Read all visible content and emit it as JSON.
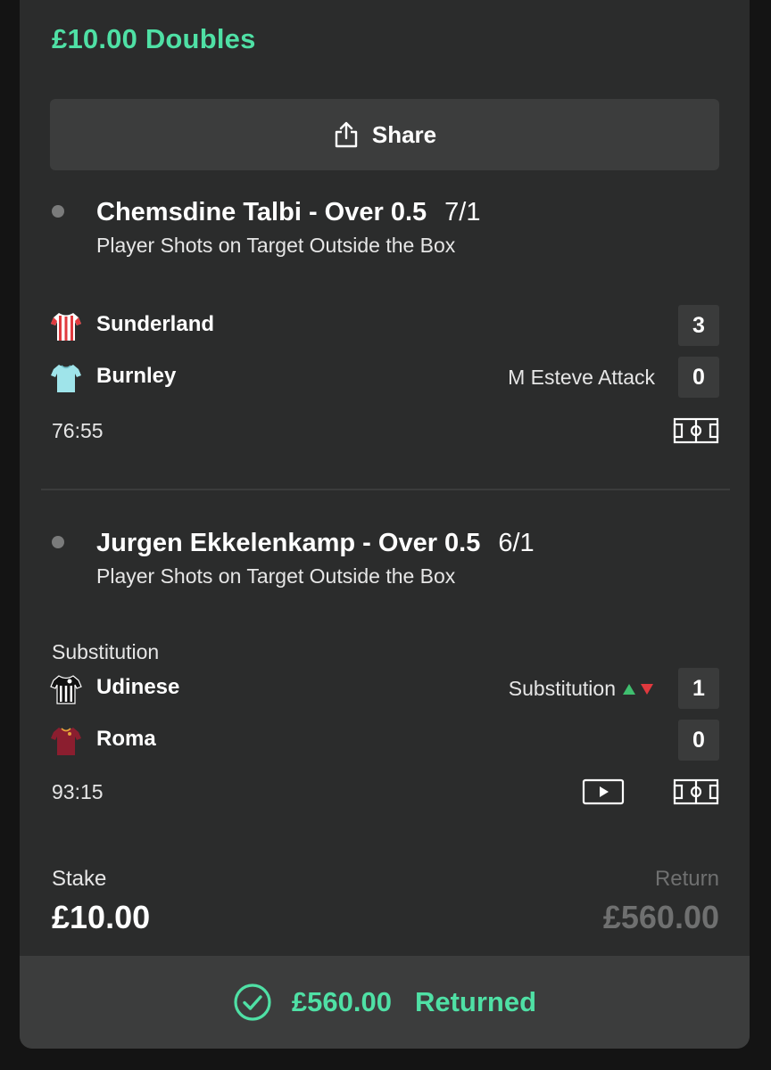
{
  "header": {
    "title": "£10.00 Doubles"
  },
  "share": {
    "label": "Share",
    "icon": "share-icon"
  },
  "selections": [
    {
      "title": "Chemsdine Talbi - Over 0.5",
      "odds": "7/1",
      "market": "Player Shots on Target Outside the Box",
      "teams": [
        {
          "name": "Sunderland",
          "score": "3",
          "note": "",
          "kit_colors": [
            "#e03a3e",
            "#ffffff"
          ]
        },
        {
          "name": "Burnley",
          "score": "0",
          "note": "M Esteve Attack",
          "kit_colors": [
            "#9fe4ea"
          ]
        }
      ],
      "clock": "76:55"
    },
    {
      "title": "Jurgen Ekkelenkamp - Over 0.5",
      "odds": "6/1",
      "market": "Player Shots on Target Outside the Box",
      "status_label": "Substitution",
      "teams": [
        {
          "name": "Udinese",
          "score": "1",
          "note": "Substitution",
          "kit_colors": [
            "#111111",
            "#ffffff"
          ]
        },
        {
          "name": "Roma",
          "score": "0",
          "note": "",
          "kit_colors": [
            "#8b1e2f"
          ]
        }
      ],
      "clock": "93:15"
    }
  ],
  "footer": {
    "stake_label": "Stake",
    "stake_value": "£10.00",
    "return_label": "Return",
    "return_value": "£560.00",
    "returned_amount": "£560.00",
    "returned_label": "Returned"
  },
  "colors": {
    "accent": "#4fe0a5",
    "up": "#3fbf6f",
    "down": "#e0393e"
  }
}
